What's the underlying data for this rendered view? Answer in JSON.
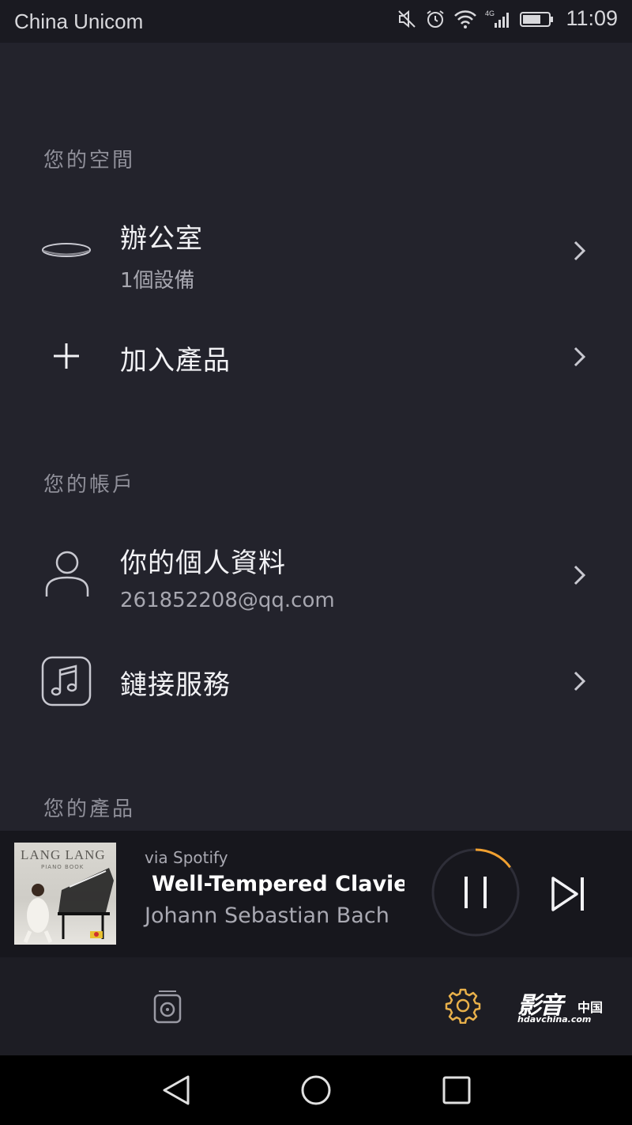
{
  "status_bar": {
    "carrier": "China Unicom",
    "network": "4G",
    "time": "11:09",
    "icons": [
      "mute-icon",
      "alarm-icon",
      "wifi-icon",
      "signal-icon",
      "battery-icon"
    ]
  },
  "sections": {
    "spaces": {
      "title": "您的空間",
      "office": {
        "title": "辦公室",
        "subtitle": "1個設備"
      },
      "add_product": {
        "title": "加入產品"
      }
    },
    "account": {
      "title": "您的帳戶",
      "profile": {
        "title": "你的個人資料",
        "email": "261852208@qq.com"
      },
      "services": {
        "title": "鏈接服務"
      }
    },
    "products": {
      "title": "您的產品"
    }
  },
  "now_playing": {
    "source": "via Spotify",
    "track": "Well-Tempered Clavier:",
    "artist": "Johann Sebastian Bach",
    "album_art_text": "LANG LANG",
    "album_art_subtext": "PIANO BOOK",
    "progress": 0.15,
    "accent_color": "#f0a030"
  },
  "bottom_tabs": {
    "items": [
      "speaker-icon",
      "gear-icon"
    ],
    "gear_color": "#e8b04a"
  },
  "watermark": {
    "main": "影音",
    "cn": "中国",
    "url": "hdavchina.com"
  },
  "nav_bar": {
    "items": [
      "back-icon",
      "home-icon",
      "recents-icon"
    ]
  }
}
